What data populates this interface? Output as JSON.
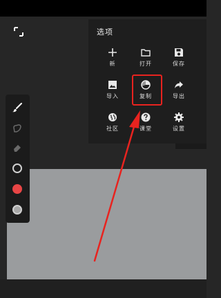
{
  "panel": {
    "title": "选项",
    "options": [
      {
        "label": "新",
        "icon": "plus-icon"
      },
      {
        "label": "打开",
        "icon": "folder-icon"
      },
      {
        "label": "保存",
        "icon": "save-icon"
      },
      {
        "label": "导入",
        "icon": "image-icon"
      },
      {
        "label": "复制",
        "icon": "copy-icon"
      },
      {
        "label": "导出",
        "icon": "share-icon"
      },
      {
        "label": "社区",
        "icon": "globe-icon"
      },
      {
        "label": "课堂",
        "icon": "help-icon"
      },
      {
        "label": "设置",
        "icon": "gear-icon"
      }
    ]
  },
  "toolbar": {
    "tools": [
      "brush-icon",
      "smudge-icon",
      "eraser-icon",
      "brush-size-icon",
      "color-swatch",
      "opacity-icon"
    ],
    "active_color": "#e84545"
  },
  "colors": {
    "highlight": "#e8231f",
    "canvas": "#9a9c9e",
    "panel": "#1e1e1e"
  }
}
